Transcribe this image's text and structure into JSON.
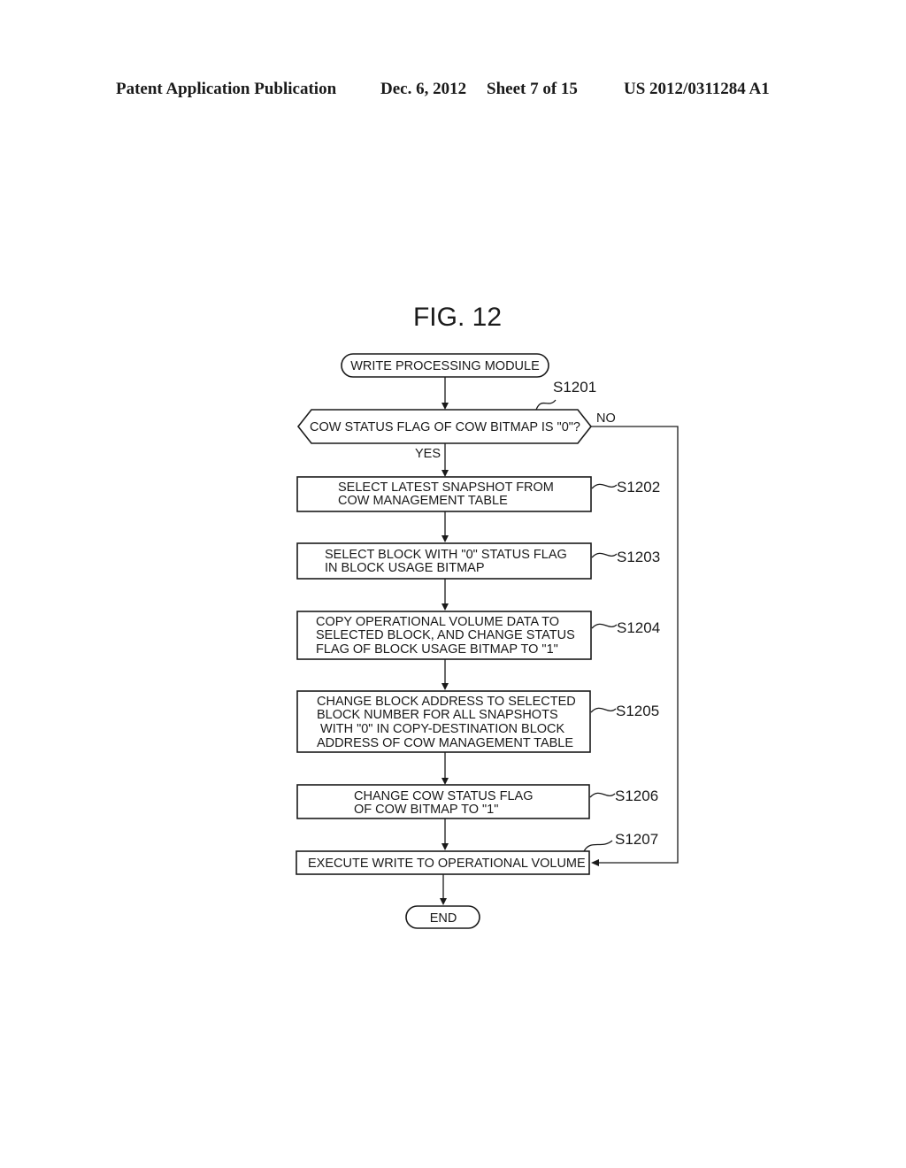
{
  "header": {
    "publication": "Patent Application Publication",
    "date": "Dec. 6, 2012",
    "sheet": "Sheet 7 of 15",
    "number": "US 2012/0311284 A1"
  },
  "figure": {
    "title": "FIG. 12",
    "start": "WRITE PROCESSING MODULE",
    "decision": {
      "step": "S1201",
      "text": "COW STATUS FLAG OF COW BITMAP IS \"0\"?",
      "yes": "YES",
      "no": "NO"
    },
    "steps": [
      {
        "id": "S1202",
        "lines": [
          "SELECT LATEST SNAPSHOT FROM",
          "COW MANAGEMENT TABLE"
        ]
      },
      {
        "id": "S1203",
        "lines": [
          "SELECT BLOCK WITH \"0\" STATUS FLAG",
          "IN BLOCK USAGE BITMAP"
        ]
      },
      {
        "id": "S1204",
        "lines": [
          "COPY OPERATIONAL VOLUME DATA TO",
          "SELECTED BLOCK, AND CHANGE STATUS",
          "FLAG OF BLOCK USAGE BITMAP TO \"1\""
        ]
      },
      {
        "id": "S1205",
        "lines": [
          "CHANGE BLOCK ADDRESS TO SELECTED",
          "BLOCK NUMBER FOR ALL SNAPSHOTS",
          " WITH \"0\" IN COPY-DESTINATION BLOCK",
          "ADDRESS OF COW MANAGEMENT TABLE"
        ]
      },
      {
        "id": "S1206",
        "lines": [
          "CHANGE COW STATUS FLAG",
          "OF COW BITMAP TO \"1\""
        ]
      },
      {
        "id": "S1207",
        "lines": [
          "EXECUTE WRITE TO OPERATIONAL VOLUME"
        ]
      }
    ],
    "end": "END"
  }
}
